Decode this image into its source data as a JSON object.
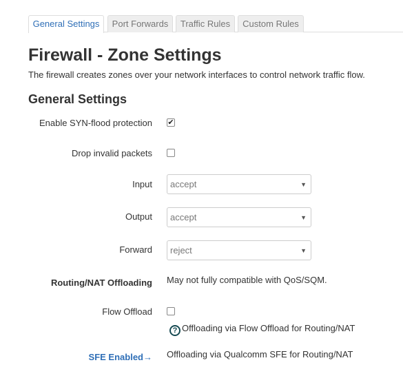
{
  "tabs": [
    {
      "label": "General Settings",
      "active": true
    },
    {
      "label": "Port Forwards",
      "active": false
    },
    {
      "label": "Traffic Rules",
      "active": false
    },
    {
      "label": "Custom Rules",
      "active": false
    }
  ],
  "page": {
    "title": "Firewall - Zone Settings",
    "description": "The firewall creates zones over your network interfaces to control network traffic flow."
  },
  "general": {
    "section_title": "General Settings",
    "syn_flood": {
      "label": "Enable SYN-flood protection",
      "checked": true
    },
    "drop_invalid": {
      "label": "Drop invalid packets",
      "checked": false
    },
    "input": {
      "label": "Input",
      "value": "accept"
    },
    "output": {
      "label": "Output",
      "value": "accept"
    },
    "forward": {
      "label": "Forward",
      "value": "reject"
    },
    "offloading": {
      "label": "Routing/NAT Offloading",
      "note": "May not fully compatible with QoS/SQM."
    },
    "flow_offload": {
      "label": "Flow Offload",
      "checked": false,
      "help": "Offloading via Flow Offload for Routing/NAT"
    },
    "sfe": {
      "label": "SFE Enabled→",
      "note": "Offloading via Qualcomm SFE for Routing/NAT"
    }
  },
  "icons": {
    "check": "✔",
    "arrow": "▼",
    "help": "?"
  },
  "colors": {
    "link": "#2f6fb7",
    "help_icon": "#164a52"
  }
}
